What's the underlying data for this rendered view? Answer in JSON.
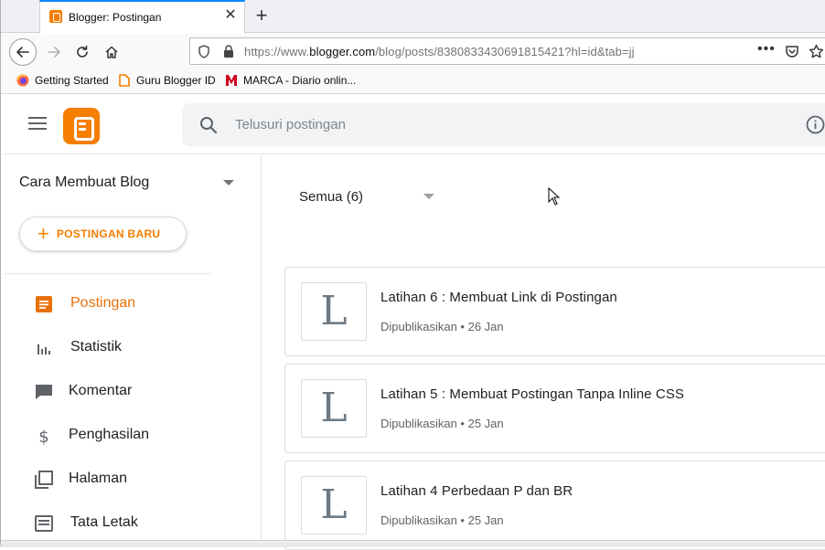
{
  "browser": {
    "tab_title": "Blogger: Postingan",
    "close_glyph": "✕",
    "new_tab_glyph": "+",
    "url_prefix": "https://www.",
    "url_domain": "blogger.com",
    "url_path": "/blog/posts/8380833430691815421?hl=id&tab=jj",
    "url_menu": "•••",
    "bookmarks": [
      {
        "label": "Getting Started"
      },
      {
        "label": "Guru Blogger ID"
      },
      {
        "label": "MARCA - Diario onlin..."
      }
    ],
    "colors": {
      "accent": "#0a84ff"
    }
  },
  "header": {
    "search_placeholder": "Telusuri postingan",
    "brand_color": "#f57d00"
  },
  "sidebar": {
    "blog_name": "Cara Membuat Blog",
    "new_post_plus": "+",
    "new_post_label": "POSTINGAN BARU",
    "items": [
      {
        "label": "Postingan",
        "icon": "posts-icon",
        "active": true
      },
      {
        "label": "Statistik",
        "icon": "stats-icon",
        "active": false
      },
      {
        "label": "Komentar",
        "icon": "comment-icon",
        "active": false
      },
      {
        "label": "Penghasilan",
        "icon": "dollar-icon",
        "active": false
      },
      {
        "label": "Halaman",
        "icon": "pages-icon",
        "active": false
      },
      {
        "label": "Tata Letak",
        "icon": "layout-icon",
        "active": false
      }
    ],
    "active_color": "#e8710a"
  },
  "main": {
    "filter_label": "Semua (6)",
    "posts": [
      {
        "thumb": "L",
        "title": "Latihan 6 : Membuat Link di Postingan",
        "meta": "Dipublikasikan • 26 Jan"
      },
      {
        "thumb": "L",
        "title": "Latihan 5 : Membuat Postingan Tanpa Inline CSS",
        "meta": "Dipublikasikan • 25 Jan"
      },
      {
        "thumb": "L",
        "title": "Latihan 4 Perbedaan P dan BR",
        "meta": "Dipublikasikan • 25 Jan"
      }
    ]
  }
}
